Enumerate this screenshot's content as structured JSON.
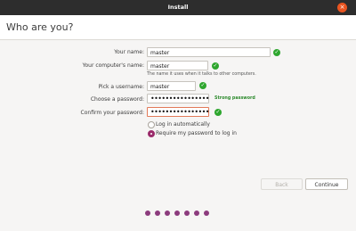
{
  "window": {
    "title": "Install",
    "close_glyph": "×"
  },
  "page": {
    "title": "Who are you?"
  },
  "form": {
    "name_label": "Your name:",
    "name_value": "master",
    "computer_label": "Your computer's name:",
    "computer_value": "master",
    "computer_hint": "The name it uses when it talks to other computers.",
    "username_label": "Pick a username:",
    "username_value": "master",
    "password_label": "Choose a password:",
    "password_value": "••••••••••••••••",
    "password_strength": "Strong password",
    "confirm_label": "Confirm your password:",
    "confirm_value": "••••••••••••••••",
    "check_glyph": "✓"
  },
  "login": {
    "auto_label": "Log in automatically",
    "require_label": "Require my password to log in",
    "selected": "require"
  },
  "buttons": {
    "back": "Back",
    "continue": "Continue"
  },
  "progress": {
    "steps": 7
  },
  "colors": {
    "accent": "#e95420",
    "check": "#2ea62e",
    "radio": "#9a2b6a",
    "dots": "#8c3b7d"
  }
}
